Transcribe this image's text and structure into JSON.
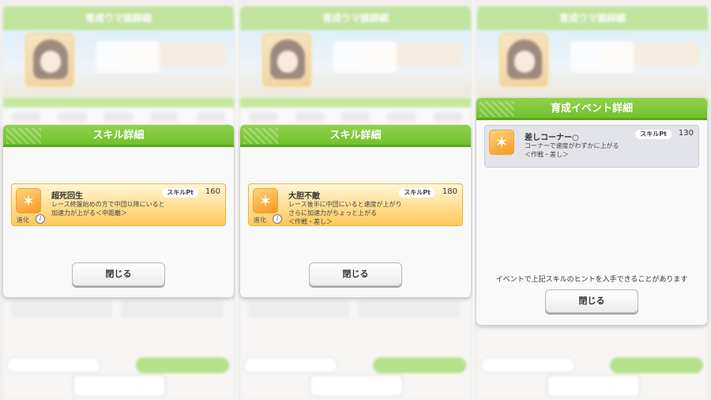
{
  "background": {
    "window_title": "育成ウマ娘詳細",
    "close_label": "閉じる"
  },
  "panels": [
    {
      "dialog_title": "スキル詳細",
      "skill": {
        "name": "超死回生",
        "pt_label": "スキルPt",
        "pt_value": "160",
        "description": "レース終盤始めの方で中団以降にいると\n加速力が上がる＜中距離＞",
        "evolve_label": "進化",
        "icon": "skill-icon"
      },
      "close_label": "閉じる"
    },
    {
      "dialog_title": "スキル詳細",
      "skill": {
        "name": "大胆不敵",
        "pt_label": "スキルPt",
        "pt_value": "180",
        "description": "レース後半に中団にいると速度が上がり\nさらに加速力がちょっと上がる\n＜作戦・差し＞",
        "evolve_label": "進化",
        "icon": "skill-icon"
      },
      "close_label": "閉じる"
    },
    {
      "dialog_title": "育成イベント詳細",
      "skill": {
        "name": "差しコーナー○",
        "pt_label": "スキルPt",
        "pt_value": "130",
        "description": "コーナーで速度がわずかに上がる\n＜作戦・差し＞",
        "icon": "skill-icon"
      },
      "note": "イベントで上記スキルのヒントを入手できることがあります",
      "close_label": "閉じる"
    }
  ],
  "colors": {
    "header_green": "#6fbf2a",
    "card_gold": "#ffc95a",
    "card_grey": "#e3e3ea"
  }
}
